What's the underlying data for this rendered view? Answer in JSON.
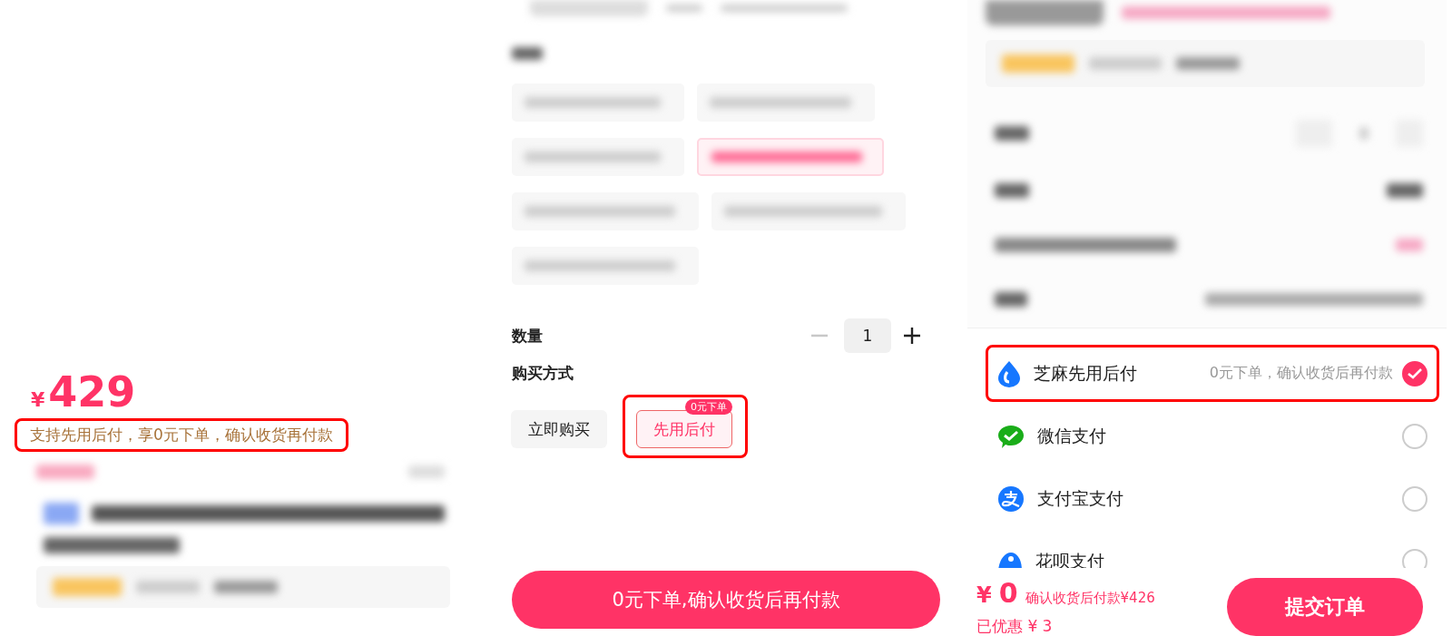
{
  "product": {
    "currency": "¥",
    "price": "429",
    "notice": {
      "text": "支持先用后付，享0元下单，确认收货再付款",
      "highlighted": true
    }
  },
  "spec_options": [
    {
      "selected": false
    },
    {
      "selected": false
    },
    {
      "selected": false
    },
    {
      "selected": true
    },
    {
      "selected": false
    },
    {
      "selected": false
    },
    {
      "selected": false
    }
  ],
  "quantity": {
    "label": "数量",
    "value": "1",
    "minus_disabled": true
  },
  "purchase": {
    "label": "购买方式",
    "options": [
      {
        "label": "立即购买",
        "selected": false,
        "highlighted": false
      },
      {
        "label": "先用后付",
        "selected": true,
        "badge": "0元下单",
        "highlighted": true
      }
    ]
  },
  "cta": "0元下单,确认收货后再付款",
  "payment_methods": [
    {
      "kind": "zhima",
      "name": "芝麻先用后付",
      "note": "0元下单，确认收货后再付款",
      "selected": true,
      "highlighted": true
    },
    {
      "kind": "wechat",
      "name": "微信支付",
      "selected": false,
      "highlighted": false
    },
    {
      "kind": "alipay",
      "name": "支付宝支付",
      "selected": false,
      "highlighted": false
    },
    {
      "kind": "huabei",
      "name": "花呗支付",
      "selected": false,
      "highlighted": false
    }
  ],
  "footer": {
    "currency": "¥",
    "amount": "0",
    "later": "确认收货后付款¥426",
    "discount": "已优惠 ¥ 3",
    "submit": "提交订单"
  }
}
